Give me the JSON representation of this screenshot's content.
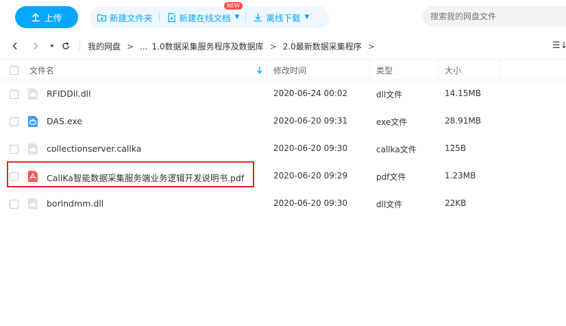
{
  "toolbar": {
    "upload_label": "上传",
    "new_folder_label": "新建文件夹",
    "new_online_doc_label": "新建在线文档",
    "new_badge": "NEW",
    "offline_download_label": "离线下载",
    "search_placeholder": "搜索我的网盘文件",
    "accent_color": "#06a7ff"
  },
  "nav": {
    "breadcrumb": [
      "我的网盘",
      "...",
      "1.0数据采集服务程序及数据库",
      "2.0最新数据采集程序"
    ]
  },
  "table": {
    "headers": {
      "name": "文件名",
      "modified": "修改时间",
      "type": "类型",
      "size": "大小"
    },
    "rows": [
      {
        "name": "RFIDDll.dll",
        "modified": "2020-06-24 00:02",
        "type": "dll文件",
        "size": "14.15MB",
        "icon": "generic-file-icon"
      },
      {
        "name": "DAS.exe",
        "modified": "2020-06-20 09:31",
        "type": "exe文件",
        "size": "28.91MB",
        "icon": "exe-file-icon"
      },
      {
        "name": "collectionserver.callka",
        "modified": "2020-06-20 09:30",
        "type": "callka文件",
        "size": "125B",
        "icon": "generic-file-icon"
      },
      {
        "name": "CallKa智能数据采集服务端业务逻辑开发说明书.pdf",
        "modified": "2020-06-20 09:29",
        "type": "pdf文件",
        "size": "1.23MB",
        "icon": "pdf-file-icon"
      },
      {
        "name": "borlndmm.dll",
        "modified": "2020-06-20 09:30",
        "type": "dll文件",
        "size": "22KB",
        "icon": "generic-file-icon"
      }
    ]
  }
}
